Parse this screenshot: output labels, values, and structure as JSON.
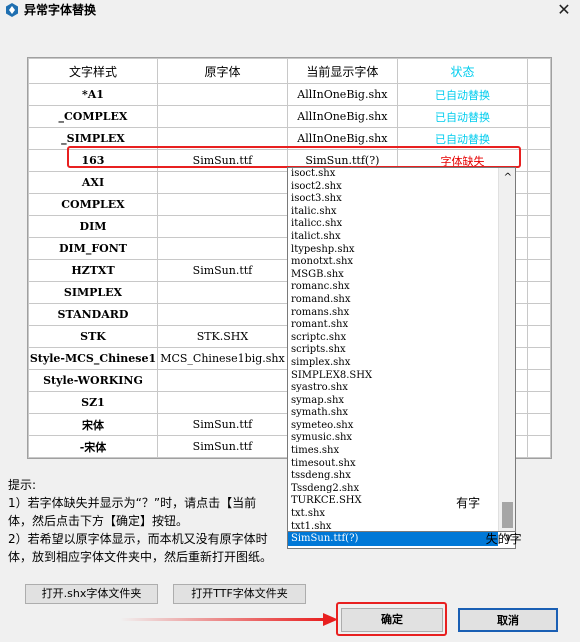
{
  "window": {
    "title": "异常字体替换",
    "close_glyph": "✕",
    "icon": "app-logo-icon"
  },
  "table": {
    "headers": [
      "文字样式",
      "原字体",
      "当前显示字体",
      "状态"
    ],
    "rows": [
      [
        "*A1",
        "",
        "AllInOneBig.shx",
        "已自动替换"
      ],
      [
        "_COMPLEX",
        "",
        "AllInOneBig.shx",
        "已自动替换"
      ],
      [
        "_SIMPLEX",
        "",
        "AllInOneBig.shx",
        "已自动替换"
      ],
      [
        "163",
        "SimSun.ttf",
        "SimSun.ttf(?)",
        "字体缺失"
      ],
      [
        "AXI",
        "",
        "",
        ""
      ],
      [
        "COMPLEX",
        "",
        "",
        ""
      ],
      [
        "DIM",
        "",
        "",
        ""
      ],
      [
        "DIM_FONT",
        "",
        "",
        ""
      ],
      [
        "HZTXT",
        "SimSun.ttf",
        "",
        ""
      ],
      [
        "SIMPLEX",
        "",
        "",
        ""
      ],
      [
        "STANDARD",
        "",
        "",
        ""
      ],
      [
        "STK",
        "STK.SHX",
        "",
        ""
      ],
      [
        "Style-MCS_Chinese1",
        "MCS_Chinese1big.shx",
        "",
        ""
      ],
      [
        "Style-WORKING",
        "",
        "",
        ""
      ],
      [
        "SZ1",
        "",
        "",
        ""
      ],
      [
        "宋体",
        "SimSun.ttf",
        "",
        ""
      ],
      [
        "-宋体",
        "SimSun.ttf",
        "",
        ""
      ]
    ]
  },
  "dropdown": {
    "items": [
      "isoct.shx",
      "isoct2.shx",
      "isoct3.shx",
      "italic.shx",
      "italicc.shx",
      "italict.shx",
      "ltypeshp.shx",
      "monotxt.shx",
      "MSGB.shx",
      "romanc.shx",
      "romand.shx",
      "romans.shx",
      "romant.shx",
      "scriptc.shx",
      "scripts.shx",
      "simplex.shx",
      "SIMPLEX8.SHX",
      "syastro.shx",
      "symap.shx",
      "symath.shx",
      "symeteo.shx",
      "symusic.shx",
      "times.shx",
      "timesout.shx",
      "tssdeng.shx",
      "Tssdeng2.shx",
      "TURKCE.SHX",
      "txt.shx",
      "txt1.shx",
      "SimSun.ttf(?)"
    ],
    "selected_value": "SimSun.ttf(?)",
    "up_arrow": "^",
    "down_arrow": "∨"
  },
  "hints": {
    "title": "提示:",
    "line1": "1）若字体缺失并显示为“？”时，请点击【当前",
    "line1_tail": "有字",
    "line2": "体，然后点击下方【确定】按钮。",
    "line3": "2）若希望以原字体显示，而本机又没有原字体时",
    "line3_tail": "失的字",
    "line4": "体，放到相应字体文件夹中，然后重新打开图纸。"
  },
  "buttons": {
    "open_shx": "打开.shx字体文件夹",
    "open_ttf": "打开TTF字体文件夹",
    "ok": "确定",
    "cancel": "取消"
  },
  "colors": {
    "ok_status": "#00ccee",
    "missing_status": "#e60000",
    "highlight": "#e82020",
    "selection": "#0078d7"
  }
}
